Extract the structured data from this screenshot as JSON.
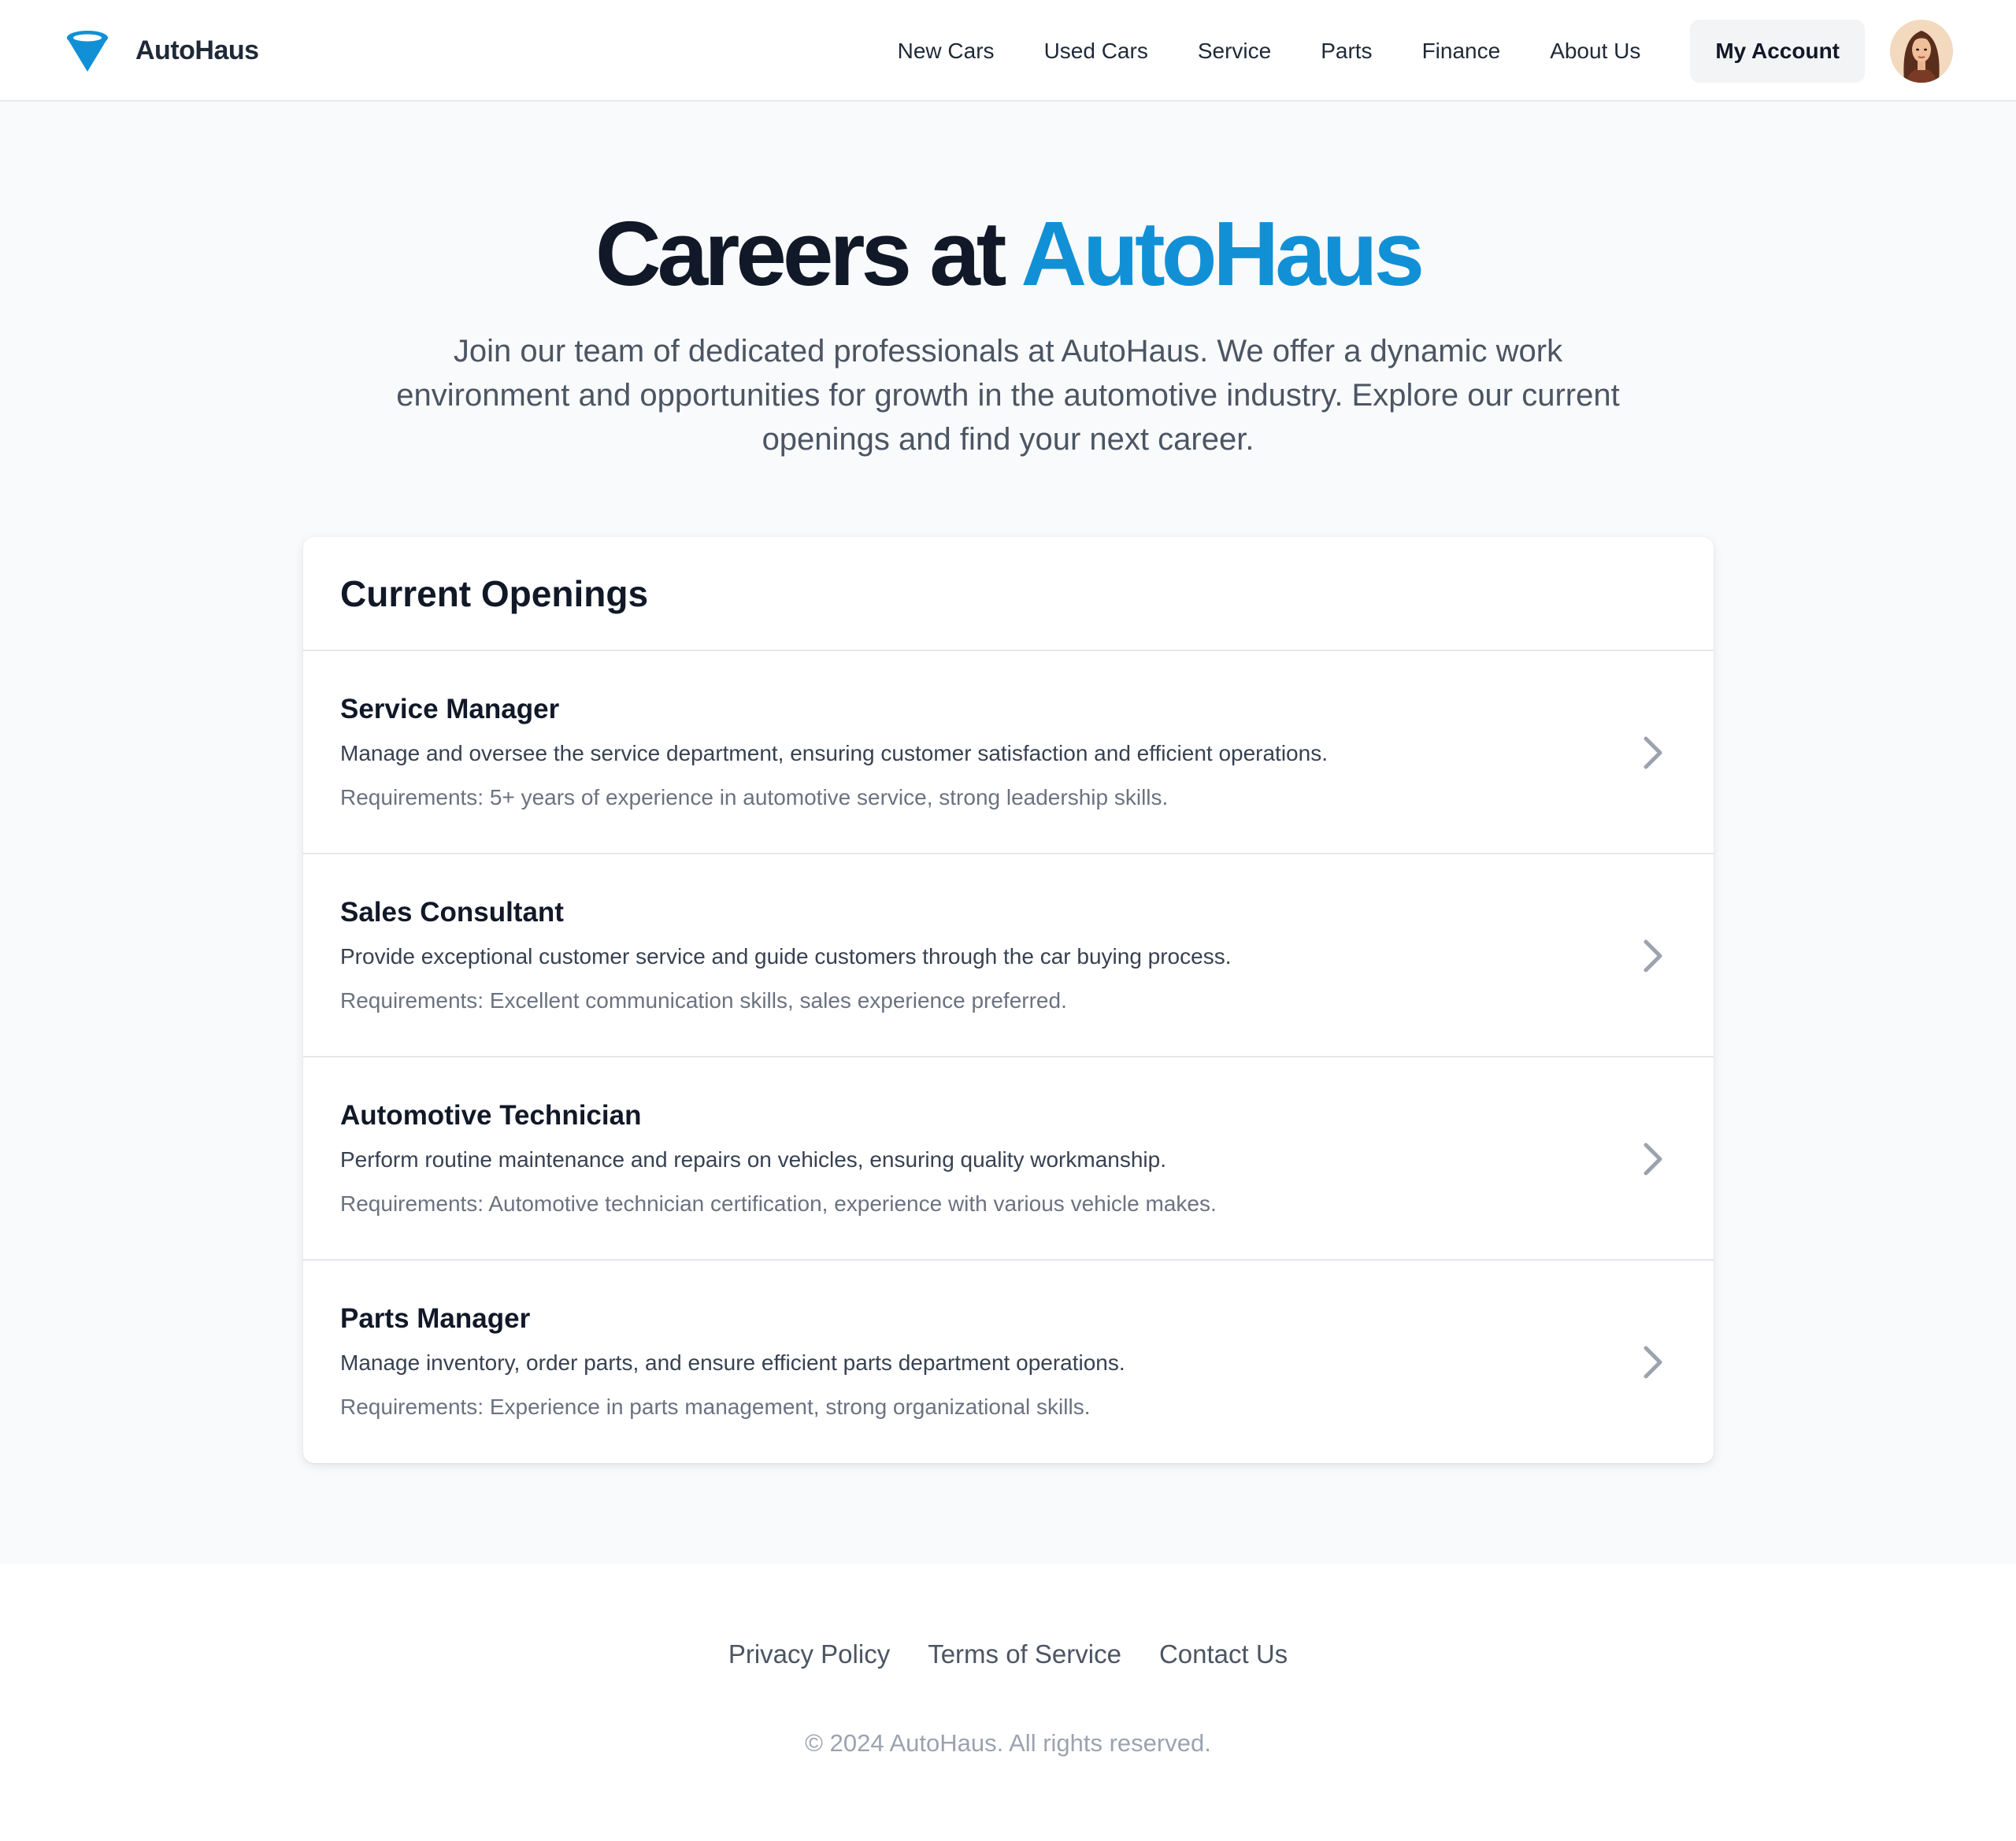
{
  "header": {
    "brand_name": "AutoHaus",
    "nav": [
      {
        "label": "New Cars"
      },
      {
        "label": "Used Cars"
      },
      {
        "label": "Service"
      },
      {
        "label": "Parts"
      },
      {
        "label": "Finance"
      },
      {
        "label": "About Us"
      }
    ],
    "account_label": "My Account"
  },
  "hero": {
    "title_prefix": "Careers at ",
    "title_accent": "AutoHaus",
    "subtitle": "Join our team of dedicated professionals at AutoHaus. We offer a dynamic work environment and opportunities for growth in the automotive industry. Explore our current openings and find your next career."
  },
  "openings": {
    "heading": "Current Openings",
    "jobs": [
      {
        "title": "Service Manager",
        "description": "Manage and oversee the service department, ensuring customer satisfaction and efficient operations.",
        "requirements": "Requirements: 5+ years of experience in automotive service, strong leadership skills."
      },
      {
        "title": "Sales Consultant",
        "description": "Provide exceptional customer service and guide customers through the car buying process.",
        "requirements": "Requirements: Excellent communication skills, sales experience preferred."
      },
      {
        "title": "Automotive Technician",
        "description": "Perform routine maintenance and repairs on vehicles, ensuring quality workmanship.",
        "requirements": "Requirements: Automotive technician certification, experience with various vehicle makes."
      },
      {
        "title": "Parts Manager",
        "description": "Manage inventory, order parts, and ensure efficient parts department operations.",
        "requirements": "Requirements: Experience in parts management, strong organizational skills."
      }
    ]
  },
  "footer": {
    "links": [
      {
        "label": "Privacy Policy"
      },
      {
        "label": "Terms of Service"
      },
      {
        "label": "Contact Us"
      }
    ],
    "copyright": "© 2024 AutoHaus. All rights reserved."
  },
  "colors": {
    "accent": "#1190d6",
    "text_dark": "#111827",
    "text_muted": "#6b7280",
    "background": "#f9fafb"
  },
  "icons": {
    "logo": "funnel-logo-icon",
    "job_action": "chevron-right-icon"
  }
}
